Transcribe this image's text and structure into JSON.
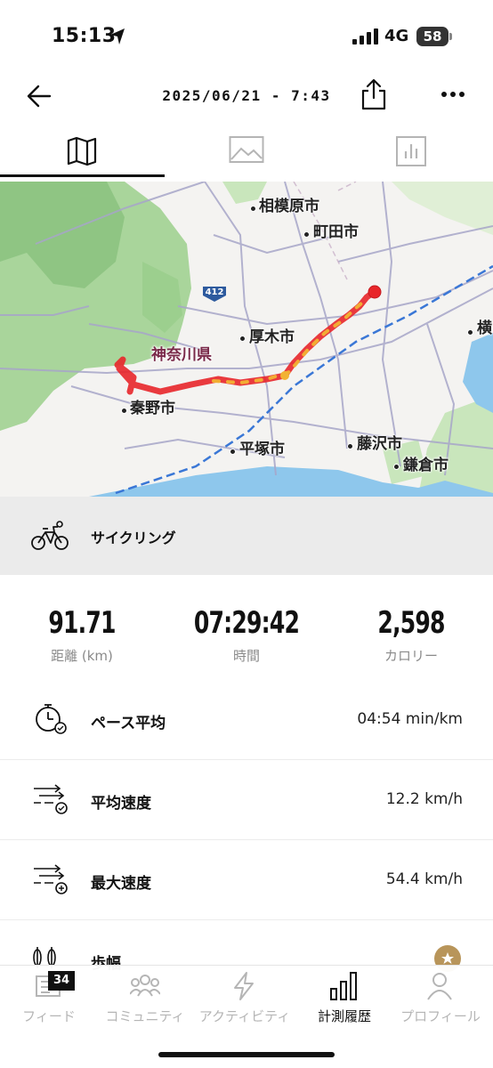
{
  "status_bar": {
    "time": "15:13",
    "network": "4G",
    "battery": "58"
  },
  "header": {
    "title": "2025/06/21 - 7:43",
    "back_icon": "arrow-left-icon",
    "share_icon": "share-icon",
    "more_icon": "more-dots-icon"
  },
  "tabs": [
    {
      "icon": "map-icon",
      "selected": true
    },
    {
      "icon": "photo-icon",
      "selected": false
    },
    {
      "icon": "chart-icon",
      "selected": false
    }
  ],
  "map": {
    "labels": {
      "sagamihara": "相模原市",
      "machida": "町田市",
      "atsugi": "厚木市",
      "kanagawa": "神奈川県",
      "hadano": "秦野市",
      "hiratsuka": "平塚市",
      "fujisawa": "藤沢市",
      "kamakura": "鎌倉市",
      "yokohama_partial": "横",
      "route_412": "412"
    },
    "colors": {
      "forest": "#a9d59b",
      "land": "#f4f3f1",
      "sea": "#8ec7ec",
      "route_red": "#e8262a",
      "route_yellow": "#f2b233",
      "rail_blue": "#3a77d6"
    }
  },
  "activity": {
    "icon": "bicycle-icon",
    "label": "サイクリング"
  },
  "summary": {
    "distance_value": "91.71",
    "distance_label": "距離 (km)",
    "duration_value": "07:29:42",
    "duration_label": "時間",
    "calories_value": "2,598",
    "calories_label": "カロリー"
  },
  "metrics": [
    {
      "icon": "stopwatch-pace-icon",
      "label": "ペース平均",
      "value": "04:54 min/km"
    },
    {
      "icon": "speed-average-icon",
      "label": "平均速度",
      "value": "12.2 km/h"
    },
    {
      "icon": "speed-max-icon",
      "label": "最大速度",
      "value": "54.4 km/h"
    },
    {
      "icon": "stride-icon",
      "label": "歩幅",
      "value": ""
    }
  ],
  "bottom_nav": [
    {
      "icon": "feed-icon",
      "label": "フィード",
      "badge": "34",
      "active": false
    },
    {
      "icon": "community-icon",
      "label": "コミュニティ",
      "active": false
    },
    {
      "icon": "activity-bolt-icon",
      "label": "アクティビティ",
      "active": false
    },
    {
      "icon": "history-bars-icon",
      "label": "計測履歴",
      "active": true
    },
    {
      "icon": "profile-icon",
      "label": "プロフィール",
      "active": false
    }
  ]
}
